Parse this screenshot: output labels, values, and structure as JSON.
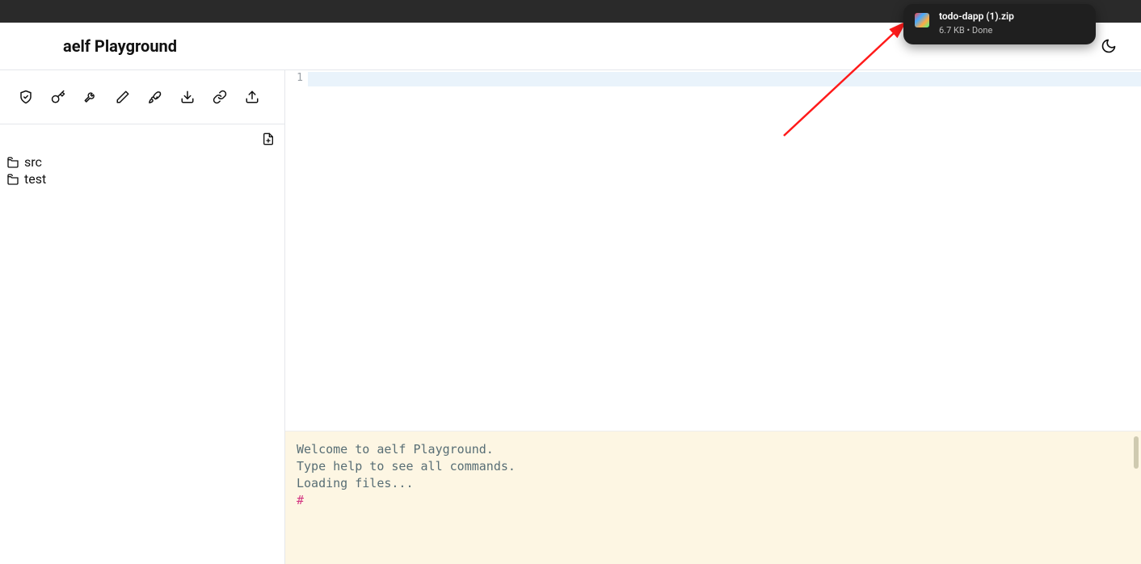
{
  "header": {
    "title": "aelf Playground"
  },
  "download": {
    "filename": "todo-dapp (1).zip",
    "meta": "6.7 KB • Done"
  },
  "toolbar": {
    "icons": [
      "shield-icon",
      "key-icon",
      "wrench-icon",
      "pencil-icon",
      "rocket-icon",
      "download-icon",
      "link-icon",
      "upload-icon"
    ]
  },
  "tree": {
    "items": [
      {
        "label": "src"
      },
      {
        "label": "test"
      }
    ]
  },
  "editor": {
    "line_number": "1"
  },
  "terminal": {
    "line1": "Welcome to aelf Playground.",
    "line2": "Type help to see all commands.",
    "line3": "Loading files...",
    "prompt": "#"
  }
}
